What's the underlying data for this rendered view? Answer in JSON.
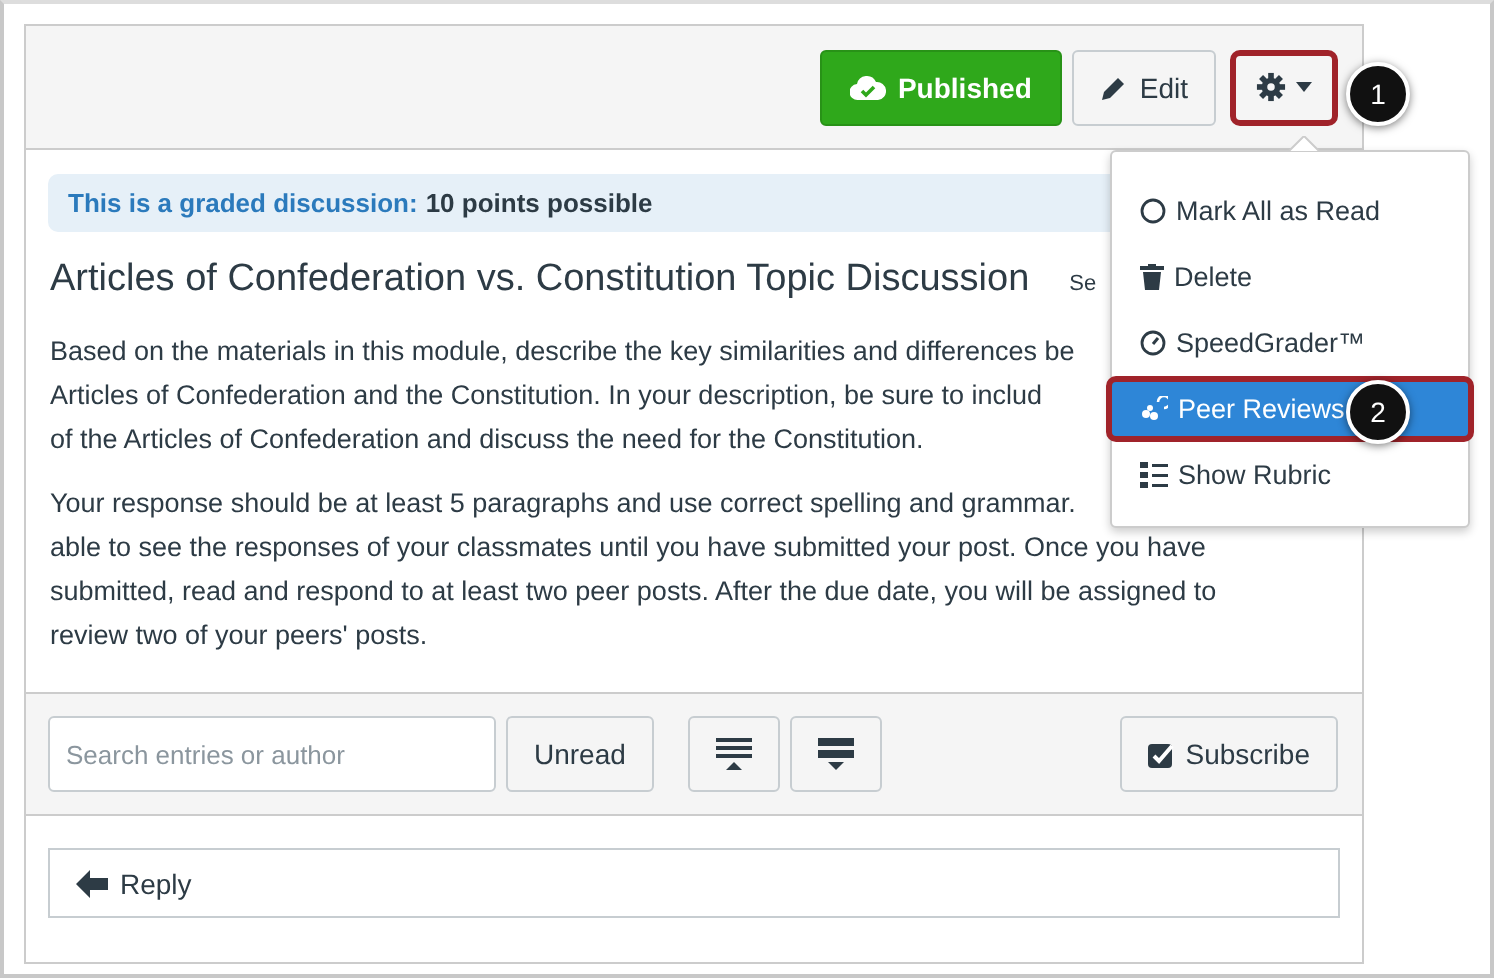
{
  "header": {
    "buttons": [
      {
        "kind": "published",
        "label": "Published"
      },
      {
        "kind": "edit",
        "label": "Edit"
      },
      {
        "kind": "gear",
        "outlined": true
      }
    ]
  },
  "banner": {
    "label": "This is a graded discussion:",
    "points": "10 points possible"
  },
  "title": "Articles of Confederation vs. Constitution Topic Discussion",
  "title_side_text": "Se",
  "paragraphs": [
    [
      "Based on the materials in this module, describe the key similarities and differences be",
      "Articles of Confederation and the Constitution. In your description, be sure to includ",
      "of the Articles of Confederation and discuss the need for the Constitution."
    ],
    [
      "Your response should be at least 5 paragraphs and use correct spelling and grammar.",
      "able to see the responses of your classmates until you have submitted your post. Once you have",
      "submitted, read and respond to at least two peer posts. After the due date, you will be assigned to",
      "review two of your peers' posts."
    ]
  ],
  "toolbar": {
    "search": {
      "placeholder": "Search entries or author"
    },
    "unread": "Unread",
    "subscribe": "Subscribe"
  },
  "reply": "Reply",
  "menu": {
    "items": [
      {
        "kind": "circle",
        "label": "Mark All as Read",
        "selected": false,
        "outlined": false
      },
      {
        "kind": "trash",
        "label": "Delete",
        "selected": false,
        "outlined": false
      },
      {
        "kind": "gauge",
        "label": "SpeedGrader™",
        "selected": false,
        "outlined": false
      },
      {
        "kind": "peers",
        "label": "Peer Reviews",
        "selected": true,
        "outlined": true
      },
      {
        "kind": "list",
        "label": "Show Rubric",
        "selected": false,
        "outlined": false
      }
    ]
  },
  "callouts": [
    {
      "label": "1"
    },
    {
      "label": "2"
    }
  ]
}
